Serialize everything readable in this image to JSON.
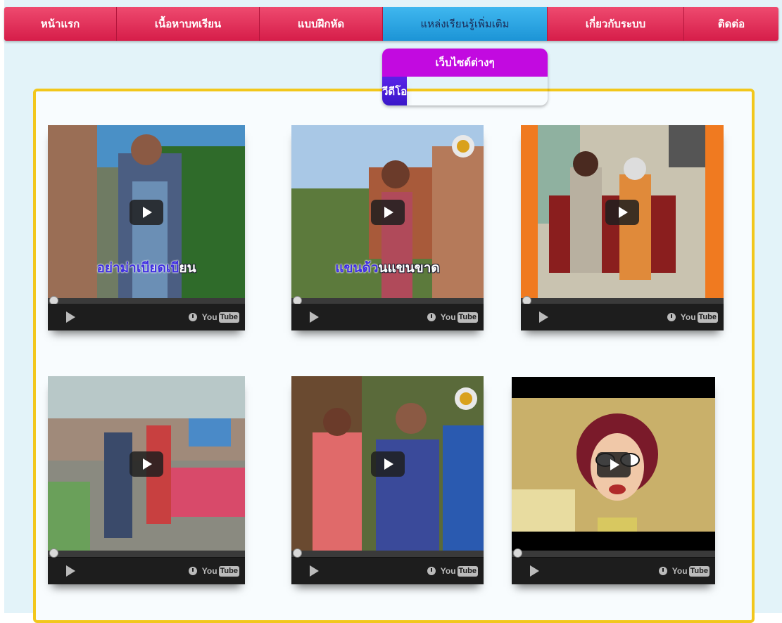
{
  "nav": {
    "items": [
      {
        "label": "หน้าแรก"
      },
      {
        "label": "เนื้อหาบทเรียน"
      },
      {
        "label": "แบบฝึกหัด"
      },
      {
        "label": "แหล่งเรียนรู้เพิ่มเติม"
      },
      {
        "label": "เกี่ยวกับระบบ"
      },
      {
        "label": "ติดต่อ"
      }
    ],
    "active_index": 3
  },
  "dropdown": {
    "items": [
      {
        "label": "เว็บไซต์ต่างๆ"
      },
      {
        "label": "วีดีโอ"
      }
    ]
  },
  "videos": [
    {
      "caption_highlight": "อย่าม่าเบียดเบี",
      "caption_rest": "ยน",
      "icon": "play-icon"
    },
    {
      "caption_highlight": "แขนด้ว",
      "caption_rest": "นแขนขาด",
      "icon": "play-icon"
    },
    {
      "caption_highlight": "",
      "caption_rest": "",
      "icon": "play-icon"
    },
    {
      "caption_highlight": "",
      "caption_rest": "",
      "icon": "play-icon"
    },
    {
      "caption_highlight": "",
      "caption_rest": "",
      "icon": "play-icon"
    },
    {
      "caption_highlight": "",
      "caption_rest": "",
      "icon": "play-icon"
    }
  ],
  "player": {
    "youtube_you": "You",
    "youtube_tube": "Tube"
  },
  "colors": {
    "nav_pink": "#d61d49",
    "nav_active_blue": "#1c94d6",
    "dropdown_magenta": "#c20ae0",
    "dropdown_purple": "#3a18c9",
    "panel_border": "#f2c71c",
    "page_background": "#e3f3f9"
  }
}
